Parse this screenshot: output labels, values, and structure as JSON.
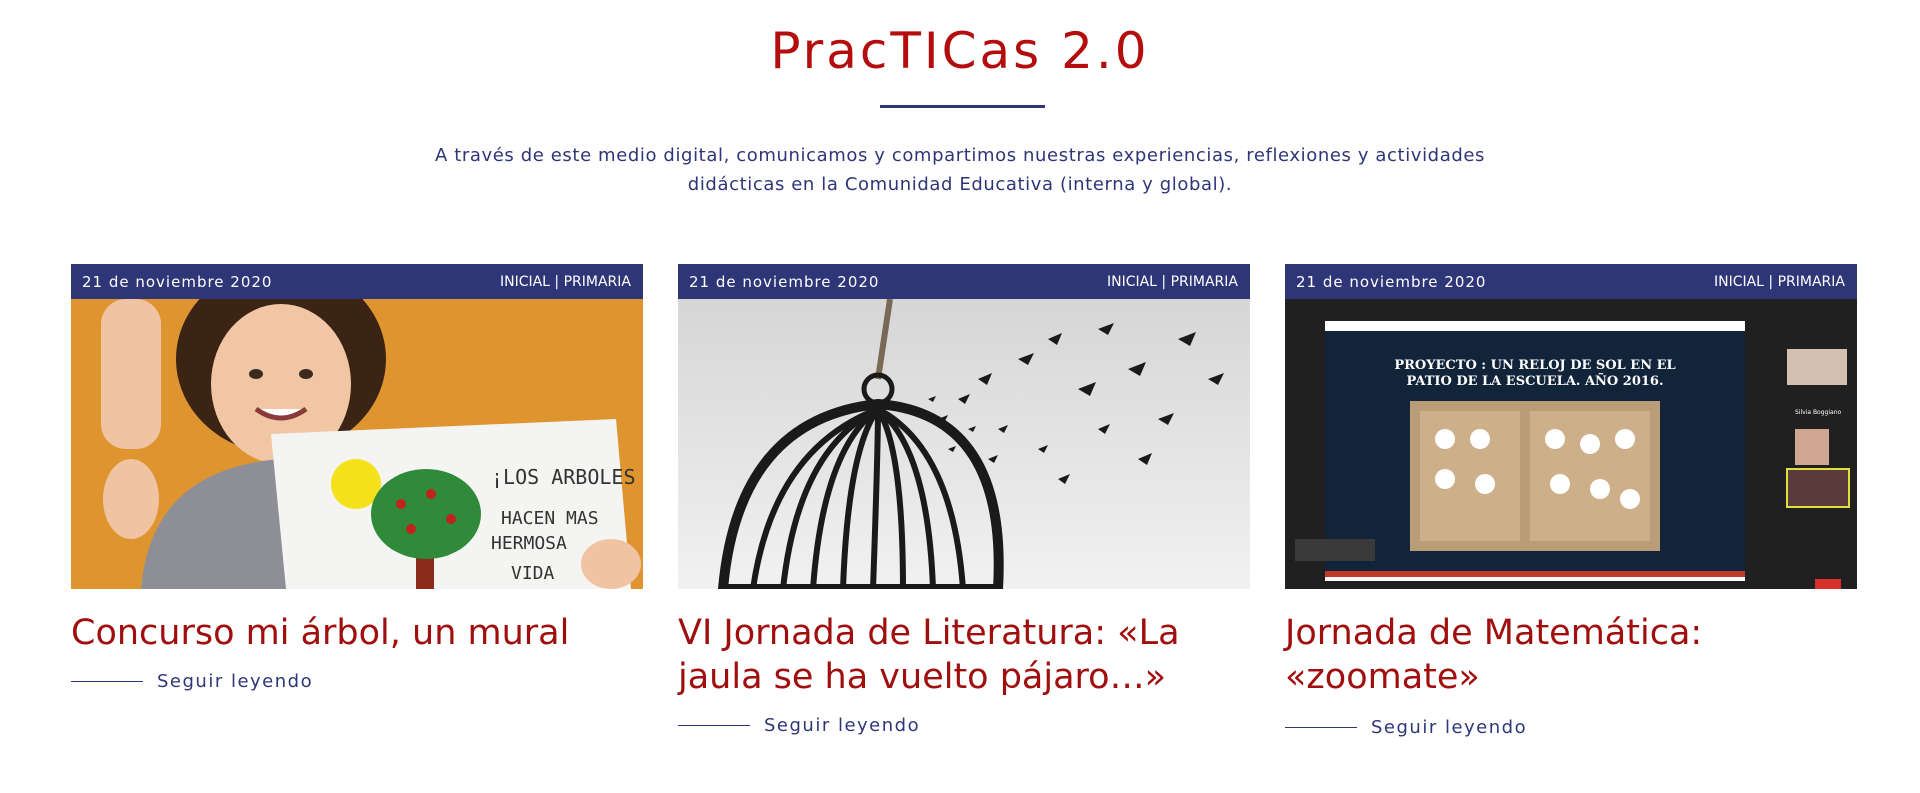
{
  "header": {
    "title": "PracTICas 2.0",
    "intro": "A través de este medio digital, comunicamos y compartimos nuestras experiencias, reflexiones y actividades didácticas en la Comunidad Educativa (interna y global)."
  },
  "colors": {
    "title_red": "#b30d0d",
    "navy": "#2e3678",
    "card_title_red": "#a00e0e"
  },
  "posts": [
    {
      "date": "21 de noviembre 2020",
      "categories": "INICIAL | PRIMARIA",
      "title": "Concurso mi árbol, un mural",
      "read_more": "Seguir leyendo",
      "image_alt": "child-holding-tree-drawing",
      "image_caption": "¡LOS ARBOLES HACEN MAS HERMOSA LA VIDA"
    },
    {
      "date": "21 de noviembre 2020",
      "categories": "INICIAL | PRIMARIA",
      "title": "VI Jornada de Literatura: «La jaula se ha vuelto pájaro…»",
      "read_more": "Seguir leyendo",
      "image_alt": "birdcage-with-birds-flying-away"
    },
    {
      "date": "21 de noviembre 2020",
      "categories": "INICIAL | PRIMARIA",
      "title": "Jornada de Matemática: «zoomate»",
      "read_more": "Seguir leyendo",
      "image_alt": "video-call-presentation",
      "slide_title": "PROYECTO : UN RELOJ DE SOL EN EL PATIO DE LA ESCUELA. AÑO 2016.",
      "participant": "Silvia Boggiano"
    }
  ]
}
